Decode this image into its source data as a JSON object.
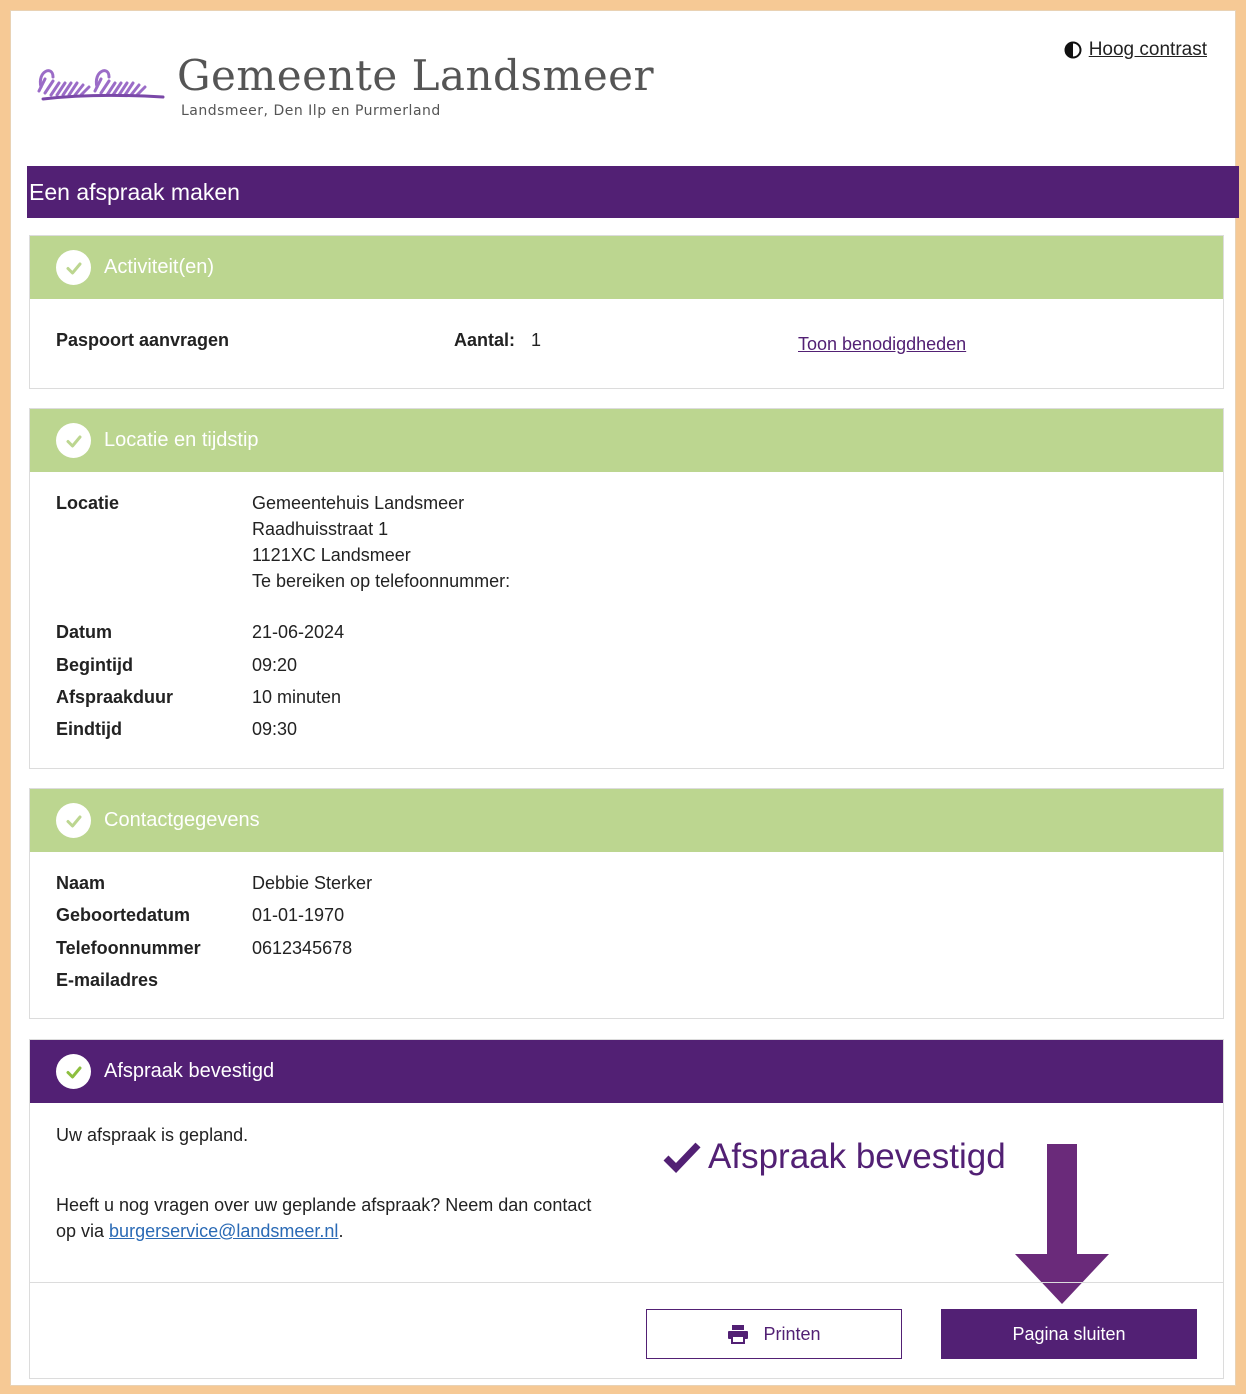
{
  "header": {
    "logo_title": "Gemeente Landsmeer",
    "logo_subtitle": "Landsmeer, Den Ilp en Purmerland",
    "contrast_label": "Hoog contrast"
  },
  "page_title": "Een afspraak maken",
  "activities": {
    "heading": "Activiteit(en)",
    "item": "Paspoort aanvragen",
    "count_label": "Aantal:",
    "count_value": "1",
    "requirements_link": "Toon benodigdheden"
  },
  "location": {
    "heading": "Locatie en tijdstip",
    "location_label": "Locatie",
    "location_lines": [
      "Gemeentehuis Landsmeer",
      "Raadhuisstraat 1",
      "1121XC Landsmeer",
      "Te bereiken op telefoonnummer:"
    ],
    "date_label": "Datum",
    "date_value": "21-06-2024",
    "start_label": "Begintijd",
    "start_value": "09:20",
    "duration_label": "Afspraakduur",
    "duration_value": "10 minuten",
    "end_label": "Eindtijd",
    "end_value": "09:30"
  },
  "contact": {
    "heading": "Contactgegevens",
    "name_label": "Naam",
    "name_value": "Debbie Sterker",
    "dob_label": "Geboortedatum",
    "dob_value": "01-01-1970",
    "phone_label": "Telefoonnummer",
    "phone_value": "0612345678",
    "email_label": "E-mailadres"
  },
  "confirmation": {
    "heading": "Afspraak bevestigd",
    "planned_text": "Uw afspraak is gepland.",
    "questions_line1": "Heeft u nog vragen over uw geplande afspraak? Neem dan contact",
    "questions_prefix": "op via ",
    "email_link": "burgerservice@landsmeer.nl",
    "questions_suffix": ".",
    "annotation_text": "Afspraak bevestigd",
    "print_label": "Printen",
    "close_label": "Pagina sluiten"
  },
  "colors": {
    "brand_purple": "#522074",
    "section_green": "#bcd690",
    "frame_orange": "#f6c995"
  },
  "icons": [
    "contrast-icon",
    "check-circle-icon",
    "checkmark-icon",
    "printer-icon",
    "down-arrow-annotation"
  ]
}
